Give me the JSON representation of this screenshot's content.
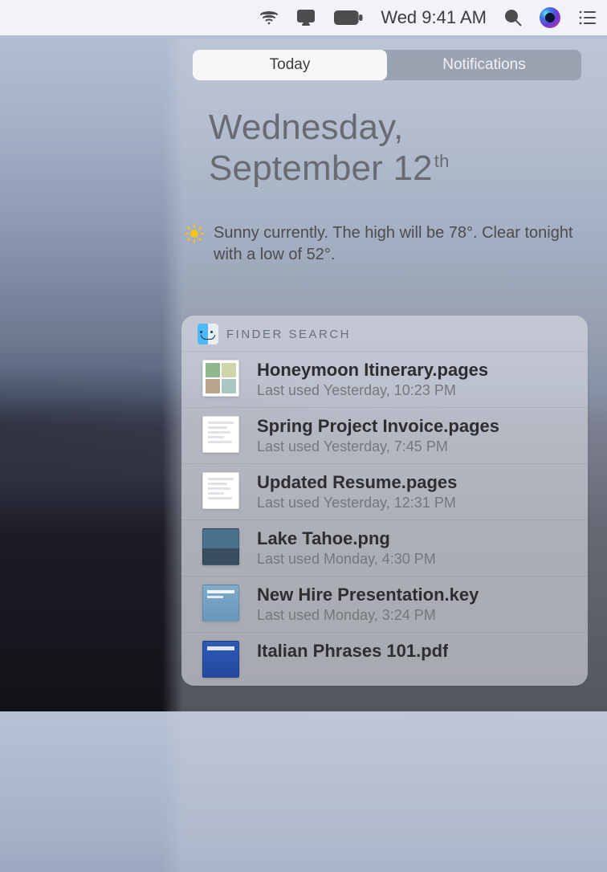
{
  "menubar": {
    "clock": "Wed 9:41 AM"
  },
  "nc": {
    "tabs": {
      "today": "Today",
      "notifications": "Notifications"
    },
    "date": {
      "line1": "Wednesday,",
      "line2_main": "September 12",
      "line2_suffix": "th"
    },
    "weather": {
      "text": "Sunny currently. The high will be 78°.  Clear tonight with a low of 52°."
    },
    "finder": {
      "title": "FINDER SEARCH",
      "items": [
        {
          "name": "Honeymoon Itinerary.pages",
          "sub": "Last used Yesterday, 10:23 PM",
          "thumb": "collage"
        },
        {
          "name": "Spring Project Invoice.pages",
          "sub": "Last used Yesterday, 7:45 PM",
          "thumb": "doc"
        },
        {
          "name": "Updated Resume.pages",
          "sub": "Last used Yesterday, 12:31 PM",
          "thumb": "doc"
        },
        {
          "name": "Lake Tahoe.png",
          "sub": "Last used Monday, 4:30 PM",
          "thumb": "photo"
        },
        {
          "name": "New Hire Presentation.key",
          "sub": "Last used Monday, 3:24 PM",
          "thumb": "key"
        },
        {
          "name": "Italian Phrases 101.pdf",
          "sub": "",
          "thumb": "pdf"
        }
      ]
    }
  }
}
